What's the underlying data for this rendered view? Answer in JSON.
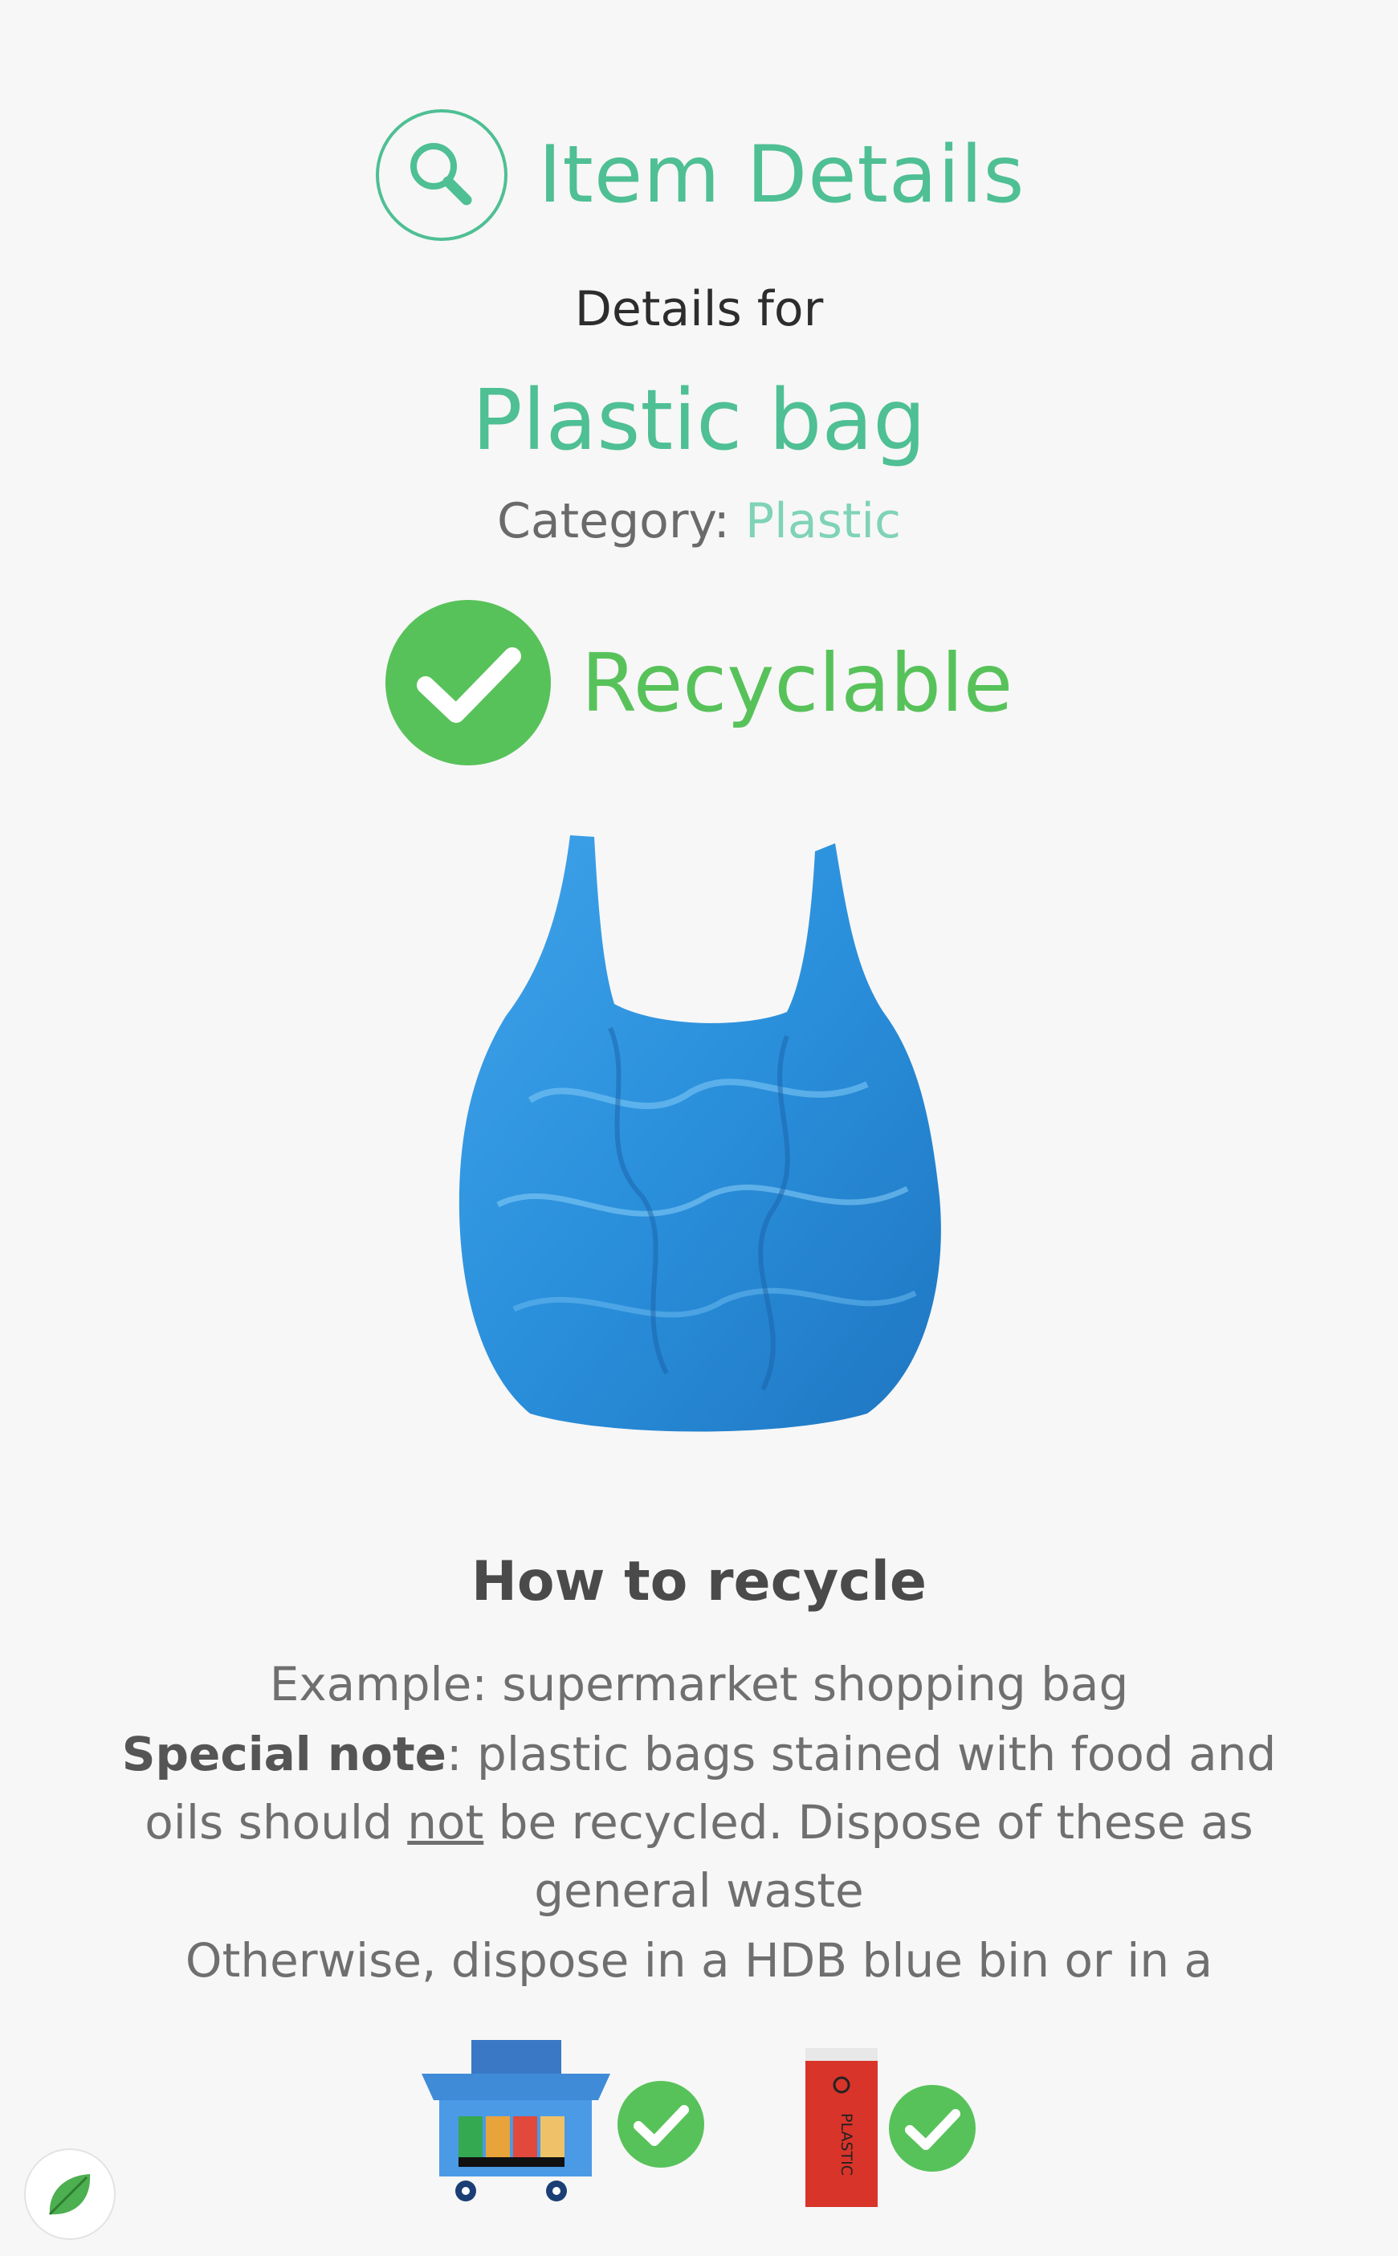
{
  "header": {
    "title": "Item Details",
    "icon": "magnifier-icon"
  },
  "details_for": "Details for",
  "item": {
    "name": "Plastic bag"
  },
  "category": {
    "label": "Category:",
    "value": "Plastic"
  },
  "status": {
    "label": "Recyclable",
    "icon": "checkmark-icon"
  },
  "image": {
    "icon": "plastic-bag-image"
  },
  "how_to": {
    "title": "How to recycle",
    "example": "Example: supermarket shopping bag",
    "note_label": "Special note",
    "note_part1": ": plastic bags stained with food and oils should ",
    "note_emph": "not",
    "note_part2": " be recycled. Dispose of these as general waste",
    "otherwise": "Otherwise, dispose in a HDB blue bin or in a"
  },
  "bins": [
    {
      "icon": "recycling-basket-icon",
      "status": "check-icon"
    },
    {
      "icon": "plastic-bin-icon",
      "label": "PLASTIC",
      "status": "check-icon"
    }
  ],
  "colors": {
    "accent": "#4fbf94",
    "recyclable": "#58c25a",
    "bag": "#2e8fd8"
  }
}
